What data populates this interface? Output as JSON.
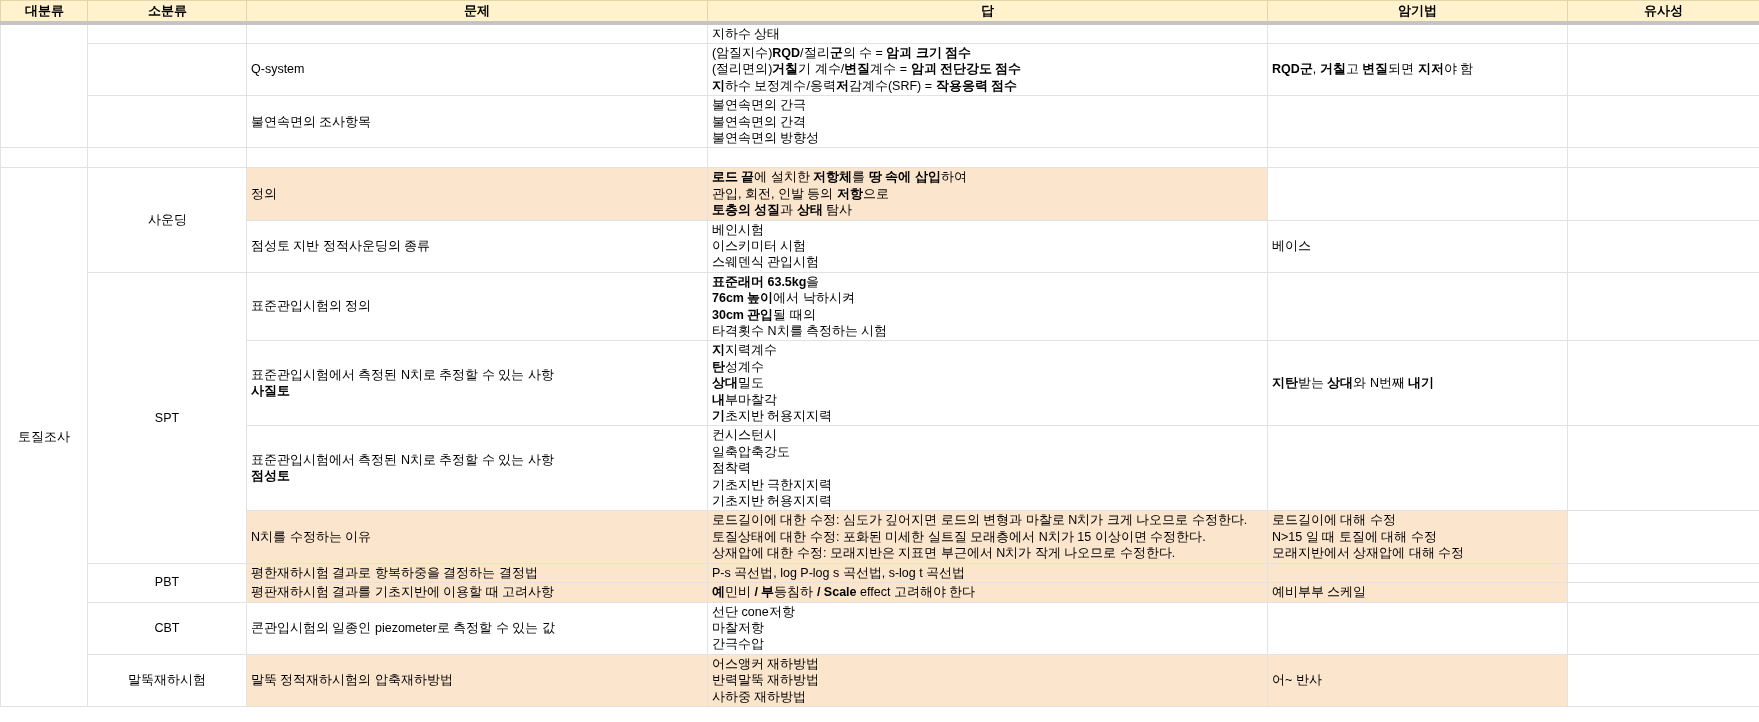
{
  "columns": [
    "대분류",
    "소분류",
    "문제",
    "답",
    "암기법",
    "유사성"
  ],
  "groups": [
    {
      "subgroups": [
        {
          "rows": [
            {
              "answer": [
                "지하수 상태"
              ],
              "highlighted": false,
              "mnemonic_highlighted": false
            }
          ]
        },
        {
          "rows": [
            {
              "question": [
                "Q-system"
              ],
              "answer": [
                "(암질지수)**RQD**/절리**군**의 수 = **암괴 크기 점수**",
                "(절리면의)**거칠**기 계수/**변질**계수 = **암괴 전단강도 점수**",
                "**지**하수 보정계수/응력**저**감계수(SRF) = **작용응력 점수**"
              ],
              "mnemonic": [
                "**RQD군**, **거칠**고 **변질**되면 **지저**야 함"
              ],
              "highlighted": false,
              "mnemonic_highlighted": false
            }
          ]
        },
        {
          "rows": [
            {
              "question": [
                "불연속면의 조사항목"
              ],
              "answer": [
                "불연속면의 간극",
                "불연속면의 간격",
                "불연속면의 방향성"
              ],
              "highlighted": false,
              "mnemonic_highlighted": false
            }
          ]
        }
      ]
    },
    {
      "subgroups": [
        {
          "rows": [
            {
              "highlighted": false,
              "mnemonic_highlighted": false
            }
          ]
        }
      ]
    },
    {
      "major": "토질조사",
      "subgroups": [
        {
          "minor": "사운딩",
          "rows": [
            {
              "question": [
                "정의"
              ],
              "answer": [
                "**로드 끝**에 설치한 **저항체**를 **땅 속에 삽입**하여",
                "관입, 회전, 인발 등의 **저항**으로",
                "**토층의 성질**과 **상태** 탐사"
              ],
              "highlighted": true,
              "mnemonic_highlighted": false
            },
            {
              "question": [
                "점성토 지반 정적사운딩의 종류"
              ],
              "answer": [
                "베인시험",
                "이스키미터 시험",
                "스웨덴식 관입시험"
              ],
              "mnemonic": [
                "베이스"
              ],
              "highlighted": false,
              "mnemonic_highlighted": false
            }
          ]
        },
        {
          "minor": "SPT",
          "rows": [
            {
              "question": [
                "표준관입시험의 정의"
              ],
              "answer": [
                "**표준래머 63.5kg**을",
                "**76cm 높이**에서 낙하시켜",
                "**30cm 관입**될 때의",
                "타격횟수 N치를 측정하는 시험"
              ],
              "highlighted": false,
              "mnemonic_highlighted": false
            },
            {
              "question": [
                "표준관입시험에서 측정된 N치로 추정할 수 있는 사항",
                "**사질토**"
              ],
              "answer": [
                "**지**지력계수",
                "**탄**성계수",
                "**상대**밀도",
                "**내**부마찰각",
                "**기**초지반 허용지지력"
              ],
              "mnemonic": [
                "**지탄**받는 **상대**와 N번째 **내기**"
              ],
              "highlighted": false,
              "mnemonic_highlighted": false
            },
            {
              "question": [
                "표준관입시험에서 측정된 N치로 추정할 수 있는 사항",
                "**점성토**"
              ],
              "answer": [
                "컨시스턴시",
                "일축압축강도",
                "점착력",
                "기초지반 극한지지력",
                "기초지반 허용지지력"
              ],
              "highlighted": false,
              "mnemonic_highlighted": false
            },
            {
              "question": [
                "N치를 수정하는 이유"
              ],
              "answer": [
                "로드길이에 대한 수정: 심도가 깊어지면 로드의 변형과 마찰로 N치가 크게 나오므로 수정한다.",
                "토질상태에 대한 수정: 포화된 미세한 실트질 모래층에서 N치가 15 이상이면 수정한다.",
                "상재압에 대한 수정: 모래지반은 지표면 부근에서 N치가 작게 나오므로 수정한다."
              ],
              "mnemonic": [
                "로드길이에 대해 수정",
                "N>15 일 때 토질에 대해 수정",
                "모래지반에서 상재압에 대해 수정"
              ],
              "highlighted": true,
              "mnemonic_highlighted": true
            }
          ]
        },
        {
          "minor": "PBT",
          "rows": [
            {
              "question": [
                "평한재하시험 결과로 항복하중을 결정하는 결정법"
              ],
              "answer": [
                "P-s 곡선법, log P-log s 곡선법, s-log t 곡선법"
              ],
              "highlighted": true,
              "mnemonic_highlighted": true
            },
            {
              "question": [
                "평판재하시험 결과를 기초지반에 이용할 때 고려사항"
              ],
              "answer": [
                "**예**민비 **/ 부**등침하 **/ Scale** effect 고려해야 한다"
              ],
              "mnemonic": [
                "예비부부 스케일"
              ],
              "highlighted": true,
              "mnemonic_highlighted": true
            }
          ]
        },
        {
          "minor": "CBT",
          "rows": [
            {
              "question": [
                "콘관입시험의 일종인 piezometer로 측정할 수 있는 값"
              ],
              "answer": [
                "선단 cone저항",
                "마찰저항",
                "간극수압"
              ],
              "highlighted": false,
              "mnemonic_highlighted": false
            }
          ]
        },
        {
          "minor": "말뚝재하시험",
          "rows": [
            {
              "question": [
                "말뚝 정적재하시험의 압축재하방법"
              ],
              "answer": [
                "어스앵커 재하방법",
                "반력말뚝 재하방법",
                "사하중 재하방법"
              ],
              "mnemonic": [
                "어~ 반사"
              ],
              "highlighted": true,
              "mnemonic_highlighted": true
            }
          ]
        }
      ]
    }
  ]
}
